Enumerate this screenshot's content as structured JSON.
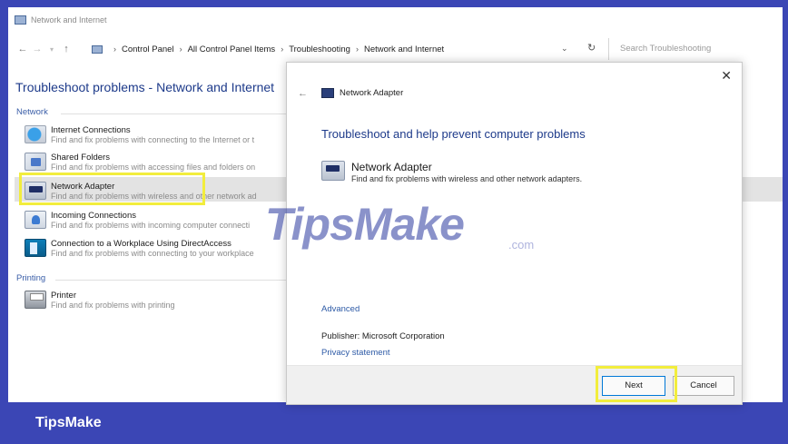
{
  "window": {
    "title": "Network and Internet"
  },
  "addressbar": {
    "breadcrumbs": [
      "Control Panel",
      "All Control Panel Items",
      "Troubleshooting",
      "Network and Internet"
    ],
    "search_placeholder": "Search Troubleshooting"
  },
  "page": {
    "title": "Troubleshoot problems - Network and Internet",
    "groups": [
      {
        "label": "Network"
      },
      {
        "label": "Printing"
      }
    ],
    "items": [
      {
        "title": "Internet Connections",
        "description": "Find and fix problems with connecting to the Internet or t",
        "icon": "globe-icon"
      },
      {
        "title": "Shared Folders",
        "description": "Find and fix problems with accessing files and folders on",
        "icon": "shared-folder-icon"
      },
      {
        "title": "Network Adapter",
        "description": "Find and fix problems with wireless and other network ad",
        "icon": "network-adapter-icon"
      },
      {
        "title": "Incoming Connections",
        "description": "Find and fix problems with incoming computer connecti",
        "icon": "incoming-connections-icon"
      },
      {
        "title": "Connection to a Workplace Using DirectAccess",
        "description": "Find and fix problems with connecting to your workplace",
        "icon": "workplace-icon"
      },
      {
        "title": "Printer",
        "description": "Find and fix problems with printing",
        "icon": "printer-icon"
      }
    ]
  },
  "dialog": {
    "header": "Network Adapter",
    "title": "Troubleshoot and help prevent computer problems",
    "item": {
      "title": "Network Adapter",
      "description": "Find and fix problems with wireless and other network adapters."
    },
    "advanced_link": "Advanced",
    "publisher_label": "Publisher:",
    "publisher_value": "Microsoft Corporation",
    "privacy_link": "Privacy statement",
    "buttons": {
      "next": "Next",
      "cancel": "Cancel"
    }
  },
  "watermark": {
    "text": "TipsMake",
    "suffix": ".com"
  },
  "banner": {
    "brand": "TipsMake"
  },
  "colors": {
    "banner": "#3b46b5",
    "highlight": "#f2ed3d",
    "link": "#2d5aa6",
    "heading": "#1d3a8a"
  }
}
